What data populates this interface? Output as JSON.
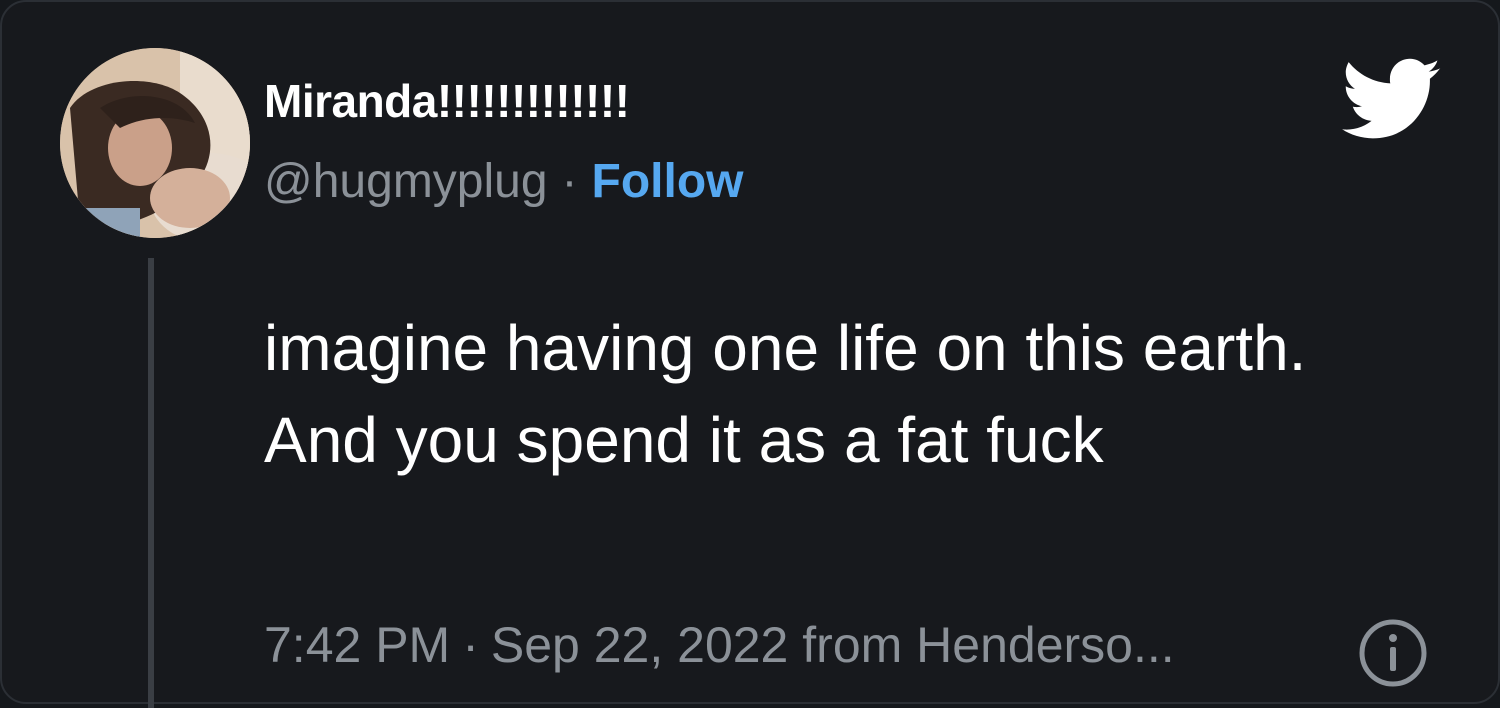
{
  "user": {
    "display_name": "Miranda!!!!!!!!!!!!!",
    "handle": "@hugmyplug",
    "separator": "·",
    "follow_label": "Follow",
    "avatar_icon": "profile-photo"
  },
  "tweet": {
    "text": "imagine having one life on this earth. And you spend it as a fat fuck",
    "time": "7:42 PM",
    "separator": "·",
    "date": "Sep 22, 2022",
    "source": "from Henderso..."
  },
  "icons": {
    "brand": "twitter-bird-icon",
    "info": "info-icon"
  },
  "colors": {
    "background": "#17191d",
    "text": "#ffffff",
    "muted": "#8b9198",
    "accent": "#56a8f0"
  }
}
